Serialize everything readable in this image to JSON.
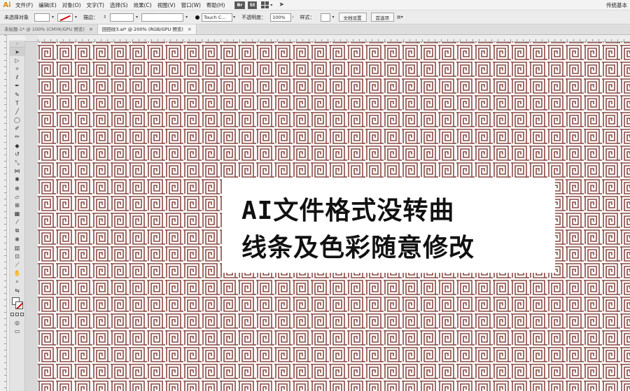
{
  "app": {
    "logo": "Ai",
    "workspace": "传统基本"
  },
  "menu": [
    "文件(F)",
    "编辑(E)",
    "对象(O)",
    "文字(T)",
    "选择(S)",
    "效果(C)",
    "视图(V)",
    "窗口(W)",
    "帮助(H)"
  ],
  "menu_badges": [
    "Br",
    "St"
  ],
  "control": {
    "selection_label": "未选择对象",
    "stroke_label": "描边：",
    "brush_value": "Touch C...",
    "opacity_label": "不透明度：",
    "opacity_value": "100%",
    "style_label": "样式：",
    "doc_settings": "文档设置",
    "preferences": "首选项"
  },
  "tabs": [
    {
      "label": "未标题-1* @ 100% (CMYK/GPU 预览)",
      "active": false
    },
    {
      "label": "回回纹3.ai* @ 200% (RGB/GPU 预览)",
      "active": true
    }
  ],
  "caption": {
    "line1": "AI文件格式没转曲",
    "line2": "线条及色彩随意修改"
  },
  "colors": {
    "pattern_stroke": "#8a4a44",
    "canvas_bg": "#ffffff"
  },
  "icons": [
    "selection-tool-icon",
    "direct-selection-icon",
    "magic-wand-icon",
    "lasso-icon",
    "pen-icon",
    "curvature-icon",
    "type-icon",
    "line-icon",
    "ellipse-icon",
    "paintbrush-icon",
    "pencil-icon",
    "eraser-icon",
    "rotate-icon",
    "scale-icon",
    "width-icon",
    "puppet-warp-icon",
    "shape-builder-icon",
    "perspective-icon",
    "mesh-icon",
    "gradient-icon",
    "eyedropper-icon",
    "blend-icon",
    "symbol-sprayer-icon",
    "column-graph-icon",
    "artboard-icon",
    "slice-icon",
    "hand-icon",
    "zoom-icon"
  ]
}
